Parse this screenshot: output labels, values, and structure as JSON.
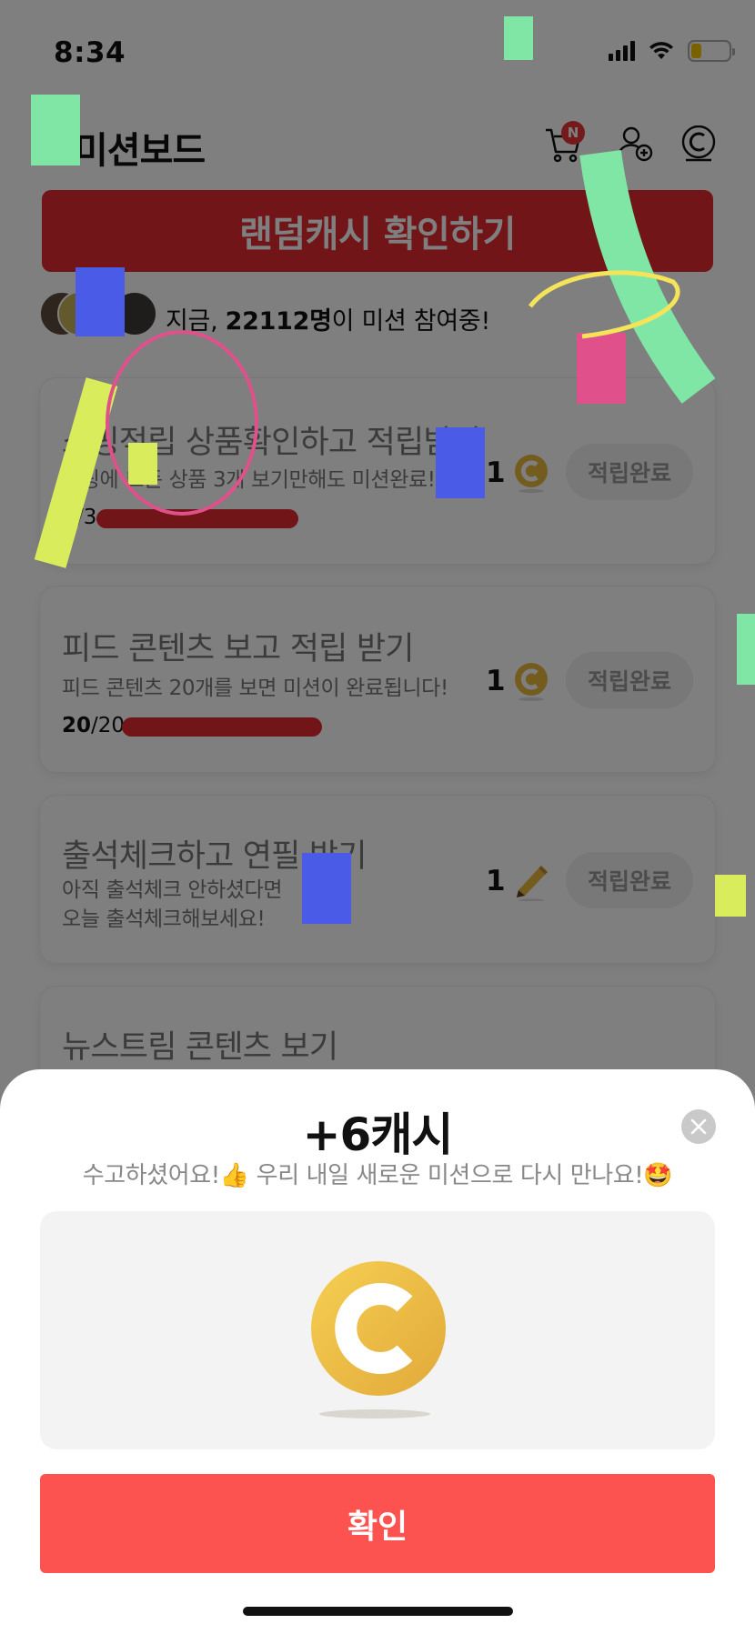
{
  "status_bar": {
    "time": "8:34"
  },
  "header": {
    "title": "미션보드",
    "cart_badge": "N",
    "random_cash_label": "랜덤캐시 확인하기"
  },
  "participants": {
    "prefix": "지금, ",
    "count": "22112명",
    "suffix": "이 미션 참여중!"
  },
  "missions": [
    {
      "title": "쇼핑적립 상품확인하고 적립받기",
      "desc": "쇼핑에 모든 상품 3개 보기만해도 미션완료!",
      "progress_current": "3",
      "progress_sep": "/3",
      "progress_ratio": 1.0,
      "reward": "1",
      "reward_icon": "coin-icon",
      "button": "적립완료"
    },
    {
      "title": "피드 콘텐츠 보고 적립 받기",
      "desc": "피드 콘텐츠 20개를 보면 미션이 완료됩니다!",
      "progress_current": "20",
      "progress_sep": "/20",
      "progress_ratio": 1.0,
      "reward": "1",
      "reward_icon": "coin-icon",
      "button": "적립완료"
    },
    {
      "title": "출석체크하고 연필 받기",
      "desc_line1": "아직 출석체크 안하셨다면",
      "desc_line2": "오늘 출석체크해보세요!",
      "reward": "1",
      "reward_icon": "pencil-icon",
      "button": "적립완료"
    },
    {
      "title": "뉴스트림 콘텐츠 보기"
    }
  ],
  "sheet": {
    "title": "+6캐시",
    "subtitle": "수고하셨어요!👍 우리 내일 새로운 미션으로 다시 만나요!🤩",
    "confirm_label": "확인"
  },
  "colors": {
    "accent": "#e22b30",
    "confirm": "#fc5250",
    "coin": "#e9b93f"
  }
}
